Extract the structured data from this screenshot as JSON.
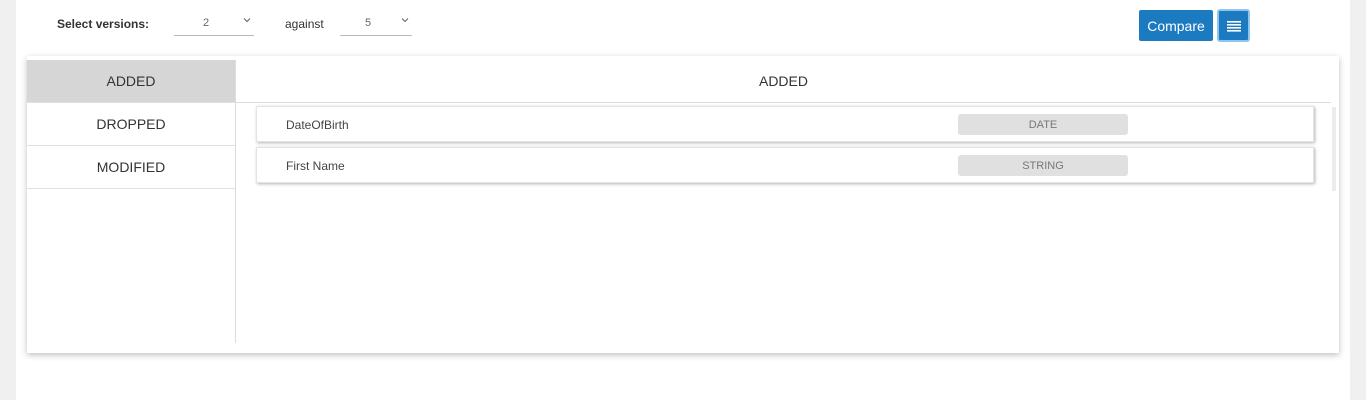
{
  "toolbar": {
    "select_label": "Select versions:",
    "version_a": "2",
    "against_label": "against",
    "version_b": "5",
    "compare_label": "Compare",
    "list_icon": "list-icon"
  },
  "sidebar": {
    "items": [
      {
        "label": "ADDED",
        "active": true
      },
      {
        "label": "DROPPED",
        "active": false
      },
      {
        "label": "MODIFIED",
        "active": false
      }
    ]
  },
  "main": {
    "heading": "ADDED",
    "rows": [
      {
        "name": "DateOfBirth",
        "type": "DATE"
      },
      {
        "name": "First Name",
        "type": "STRING"
      }
    ]
  },
  "colors": {
    "accent": "#1b7ac0",
    "active_tab": "#d6d6d6",
    "badge": "#e0e0e0"
  }
}
